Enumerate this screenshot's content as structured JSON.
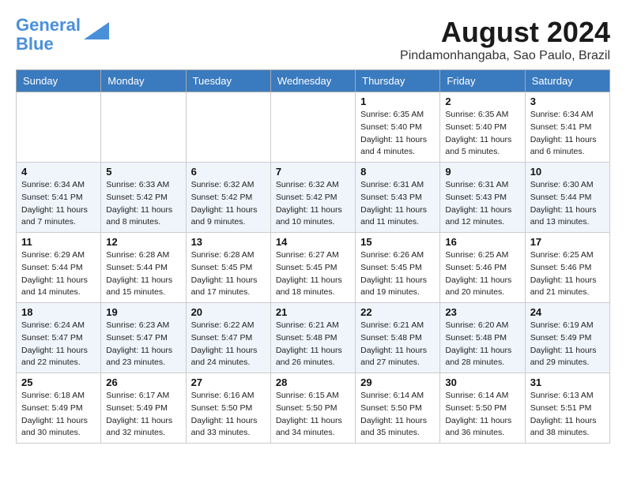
{
  "header": {
    "logo_line1": "General",
    "logo_line2": "Blue",
    "month_year": "August 2024",
    "location": "Pindamonhangaba, Sao Paulo, Brazil"
  },
  "weekdays": [
    "Sunday",
    "Monday",
    "Tuesday",
    "Wednesday",
    "Thursday",
    "Friday",
    "Saturday"
  ],
  "weeks": [
    [
      {
        "day": "",
        "info": ""
      },
      {
        "day": "",
        "info": ""
      },
      {
        "day": "",
        "info": ""
      },
      {
        "day": "",
        "info": ""
      },
      {
        "day": "1",
        "info": "Sunrise: 6:35 AM\nSunset: 5:40 PM\nDaylight: 11 hours\nand 4 minutes."
      },
      {
        "day": "2",
        "info": "Sunrise: 6:35 AM\nSunset: 5:40 PM\nDaylight: 11 hours\nand 5 minutes."
      },
      {
        "day": "3",
        "info": "Sunrise: 6:34 AM\nSunset: 5:41 PM\nDaylight: 11 hours\nand 6 minutes."
      }
    ],
    [
      {
        "day": "4",
        "info": "Sunrise: 6:34 AM\nSunset: 5:41 PM\nDaylight: 11 hours\nand 7 minutes."
      },
      {
        "day": "5",
        "info": "Sunrise: 6:33 AM\nSunset: 5:42 PM\nDaylight: 11 hours\nand 8 minutes."
      },
      {
        "day": "6",
        "info": "Sunrise: 6:32 AM\nSunset: 5:42 PM\nDaylight: 11 hours\nand 9 minutes."
      },
      {
        "day": "7",
        "info": "Sunrise: 6:32 AM\nSunset: 5:42 PM\nDaylight: 11 hours\nand 10 minutes."
      },
      {
        "day": "8",
        "info": "Sunrise: 6:31 AM\nSunset: 5:43 PM\nDaylight: 11 hours\nand 11 minutes."
      },
      {
        "day": "9",
        "info": "Sunrise: 6:31 AM\nSunset: 5:43 PM\nDaylight: 11 hours\nand 12 minutes."
      },
      {
        "day": "10",
        "info": "Sunrise: 6:30 AM\nSunset: 5:44 PM\nDaylight: 11 hours\nand 13 minutes."
      }
    ],
    [
      {
        "day": "11",
        "info": "Sunrise: 6:29 AM\nSunset: 5:44 PM\nDaylight: 11 hours\nand 14 minutes."
      },
      {
        "day": "12",
        "info": "Sunrise: 6:28 AM\nSunset: 5:44 PM\nDaylight: 11 hours\nand 15 minutes."
      },
      {
        "day": "13",
        "info": "Sunrise: 6:28 AM\nSunset: 5:45 PM\nDaylight: 11 hours\nand 17 minutes."
      },
      {
        "day": "14",
        "info": "Sunrise: 6:27 AM\nSunset: 5:45 PM\nDaylight: 11 hours\nand 18 minutes."
      },
      {
        "day": "15",
        "info": "Sunrise: 6:26 AM\nSunset: 5:45 PM\nDaylight: 11 hours\nand 19 minutes."
      },
      {
        "day": "16",
        "info": "Sunrise: 6:25 AM\nSunset: 5:46 PM\nDaylight: 11 hours\nand 20 minutes."
      },
      {
        "day": "17",
        "info": "Sunrise: 6:25 AM\nSunset: 5:46 PM\nDaylight: 11 hours\nand 21 minutes."
      }
    ],
    [
      {
        "day": "18",
        "info": "Sunrise: 6:24 AM\nSunset: 5:47 PM\nDaylight: 11 hours\nand 22 minutes."
      },
      {
        "day": "19",
        "info": "Sunrise: 6:23 AM\nSunset: 5:47 PM\nDaylight: 11 hours\nand 23 minutes."
      },
      {
        "day": "20",
        "info": "Sunrise: 6:22 AM\nSunset: 5:47 PM\nDaylight: 11 hours\nand 24 minutes."
      },
      {
        "day": "21",
        "info": "Sunrise: 6:21 AM\nSunset: 5:48 PM\nDaylight: 11 hours\nand 26 minutes."
      },
      {
        "day": "22",
        "info": "Sunrise: 6:21 AM\nSunset: 5:48 PM\nDaylight: 11 hours\nand 27 minutes."
      },
      {
        "day": "23",
        "info": "Sunrise: 6:20 AM\nSunset: 5:48 PM\nDaylight: 11 hours\nand 28 minutes."
      },
      {
        "day": "24",
        "info": "Sunrise: 6:19 AM\nSunset: 5:49 PM\nDaylight: 11 hours\nand 29 minutes."
      }
    ],
    [
      {
        "day": "25",
        "info": "Sunrise: 6:18 AM\nSunset: 5:49 PM\nDaylight: 11 hours\nand 30 minutes."
      },
      {
        "day": "26",
        "info": "Sunrise: 6:17 AM\nSunset: 5:49 PM\nDaylight: 11 hours\nand 32 minutes."
      },
      {
        "day": "27",
        "info": "Sunrise: 6:16 AM\nSunset: 5:50 PM\nDaylight: 11 hours\nand 33 minutes."
      },
      {
        "day": "28",
        "info": "Sunrise: 6:15 AM\nSunset: 5:50 PM\nDaylight: 11 hours\nand 34 minutes."
      },
      {
        "day": "29",
        "info": "Sunrise: 6:14 AM\nSunset: 5:50 PM\nDaylight: 11 hours\nand 35 minutes."
      },
      {
        "day": "30",
        "info": "Sunrise: 6:14 AM\nSunset: 5:50 PM\nDaylight: 11 hours\nand 36 minutes."
      },
      {
        "day": "31",
        "info": "Sunrise: 6:13 AM\nSunset: 5:51 PM\nDaylight: 11 hours\nand 38 minutes."
      }
    ]
  ]
}
